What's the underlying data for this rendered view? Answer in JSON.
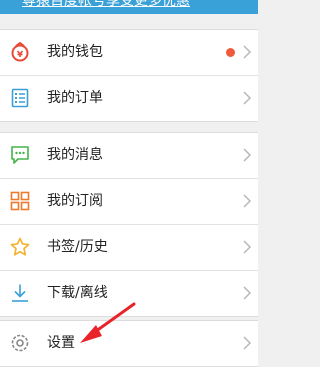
{
  "top_banner": {
    "text": "尊猿百度帐号享受更多优惠"
  },
  "menu": {
    "wallet": {
      "label": "我的钱包"
    },
    "orders": {
      "label": "我的订单"
    },
    "messages": {
      "label": "我的消息"
    },
    "subscriptions": {
      "label": "我的订阅"
    },
    "bookmarks": {
      "label": "书签/历史"
    },
    "downloads": {
      "label": "下载/离线"
    },
    "settings": {
      "label": "设置"
    }
  },
  "colors": {
    "accent_blue": "#3aa0d8",
    "icon_orange": "#f07a2c",
    "icon_green": "#46b34b",
    "badge_red": "#f05a3c",
    "annotation_red": "#e8232a"
  },
  "icons": {
    "wallet": "wallet-icon",
    "orders": "orders-icon",
    "messages": "message-icon",
    "subscriptions": "grid-icon",
    "bookmarks": "star-icon",
    "downloads": "download-icon",
    "settings": "gear-icon"
  }
}
